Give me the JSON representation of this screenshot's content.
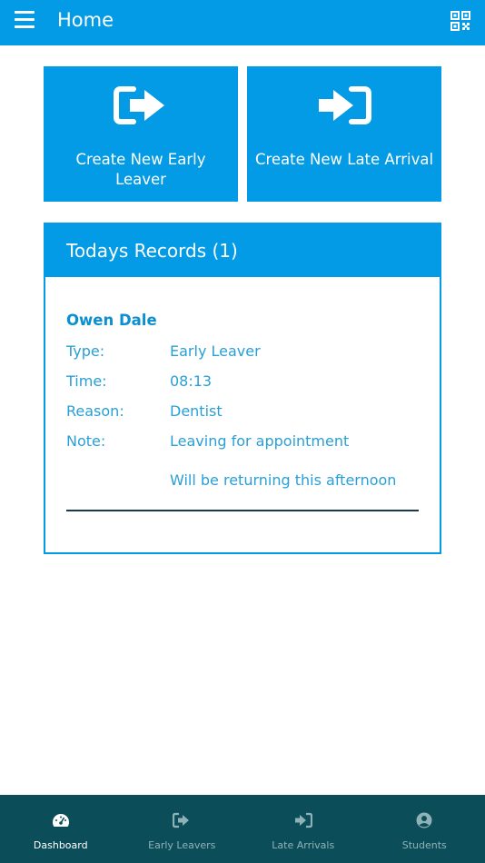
{
  "header": {
    "title": "Home",
    "menu_icon": "hamburger-menu-icon",
    "qr_icon": "qr-code-icon"
  },
  "tiles": {
    "early_leaver": {
      "label": "Create New Early Leaver",
      "icon": "sign-out-icon"
    },
    "late_arrival": {
      "label": "Create New Late Arrival",
      "icon": "sign-in-icon"
    }
  },
  "records": {
    "title": "Todays Records (1)",
    "items": [
      {
        "name": "Owen Dale",
        "type_label": "Type:",
        "type": "Early Leaver",
        "time_label": "Time:",
        "time": "08:13",
        "reason_label": "Reason:",
        "reason": "Dentist",
        "note_label": "Note:",
        "note": "Leaving for appointment",
        "note_extra": "Will be returning this afternoon"
      }
    ]
  },
  "nav": {
    "items": [
      {
        "label": "Dashboard",
        "icon": "dashboard-gauge-icon",
        "active": true
      },
      {
        "label": "Early Leavers",
        "icon": "sign-out-icon",
        "active": false
      },
      {
        "label": "Late Arrivals",
        "icon": "sign-in-icon",
        "active": false
      },
      {
        "label": "Students",
        "icon": "user-circle-icon",
        "active": false
      }
    ]
  },
  "colors": {
    "primary": "#039be5",
    "nav_background": "#0b4e59",
    "record_name": "#0b8fcf",
    "record_text": "#2a9fd6"
  }
}
